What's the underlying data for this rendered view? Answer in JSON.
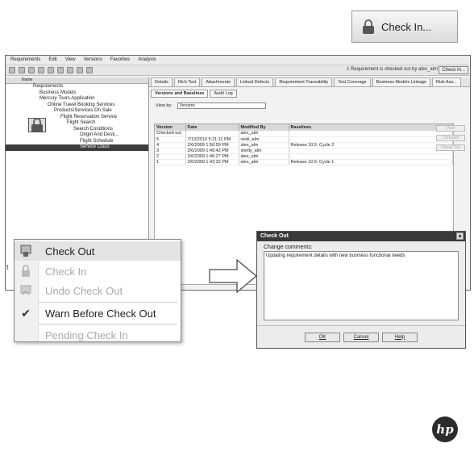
{
  "top_button": {
    "label": "Check In...",
    "icon": "lock-icon"
  },
  "app": {
    "menus": [
      "Requirements",
      "Edit",
      "View",
      "Versions",
      "Favorites",
      "Analysis"
    ],
    "status_text": "1 Requirement is checked out by alex_alm",
    "toolbar_checkin": "Check In...",
    "tree_header": "Name",
    "tree": [
      "Requirements",
      "Business Models",
      "Mercury Tours Application",
      "Online Travel Booking Services",
      "Products/Services On Sale",
      "Flight Reservation Service",
      "Flight Search",
      "Search Conditions",
      "Origin And Desti...",
      "Flight Schedule",
      "Service Class"
    ],
    "tabs": [
      "Details",
      "Rich Text",
      "Attachments",
      "Linked Defects",
      "Requirement Traceability",
      "Test Coverage",
      "Business Models Linkage",
      "Risk Ass..."
    ],
    "subtabs": [
      "Versions and Baselines",
      "Audit Log"
    ],
    "view_by_label": "View by:",
    "view_by_value": "Versions",
    "columns": [
      "Version",
      "Date",
      "Modified By",
      "Baselines"
    ],
    "rows": [
      [
        "Checked out",
        "",
        "alex_alm",
        ""
      ],
      [
        "5",
        "7/13/2010 5:21:11 PM",
        "vesli_alm",
        ""
      ],
      [
        "4",
        "2/6/2009 1:50:59 PM",
        "alex_alm",
        "Release 10.5: Cycle 2"
      ],
      [
        "3",
        "2/6/2009 1:49:42 PM",
        "shelly_alm",
        ""
      ],
      [
        "2",
        "2/6/2009 1:46:27 PM",
        "alex_alm",
        ""
      ],
      [
        "1",
        "2/6/2009 1:43:32 PM",
        "alex_alm",
        "Release 10.5: Cycle 1"
      ]
    ],
    "side_buttons": [
      "View",
      "Compare",
      "Check Out"
    ]
  },
  "menu": {
    "items": [
      {
        "label": "Check Out",
        "icon": "check-out-icon",
        "state": "highlighted"
      },
      {
        "label": "Check In",
        "icon": "check-in-lock-icon",
        "state": "disabled"
      },
      {
        "label": "Undo Check Out",
        "icon": "undo-check-out-icon",
        "state": "disabled"
      },
      {
        "label": "Warn Before Check Out",
        "icon": "checkmark-icon",
        "state": "checked"
      },
      {
        "label": "Pending Check In",
        "icon": "",
        "state": "disabled"
      }
    ],
    "stray_text": "t"
  },
  "dialog": {
    "title": "Check Out",
    "label": "Change comments:",
    "comment": "Updating requirement details with new business functional needs",
    "buttons": [
      "OK",
      "Cancel",
      "Help"
    ]
  },
  "logo": "hp"
}
